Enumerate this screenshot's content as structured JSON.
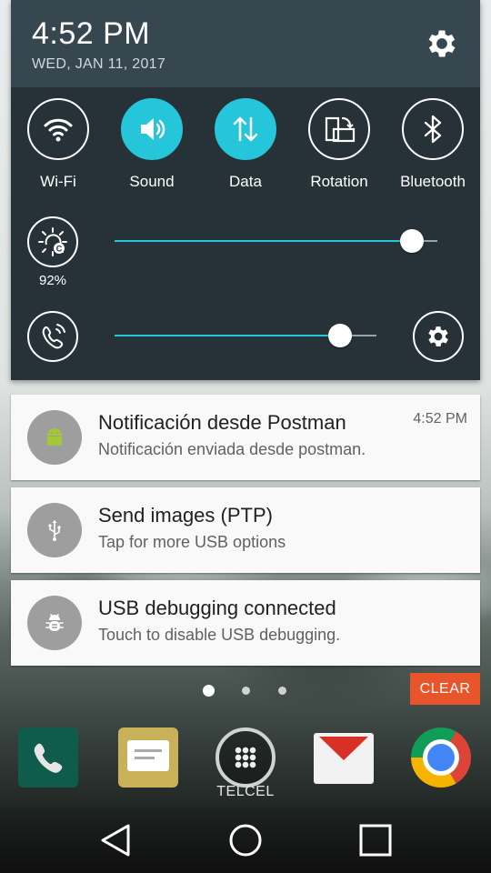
{
  "status": {
    "time": "4:52 PM",
    "date": "WED, JAN 11, 2017"
  },
  "quick_settings": {
    "toggles": [
      {
        "label": "Wi-Fi",
        "icon": "wifi-icon",
        "active": false
      },
      {
        "label": "Sound",
        "icon": "volume-icon",
        "active": true
      },
      {
        "label": "Data",
        "icon": "data-arrows-icon",
        "active": true
      },
      {
        "label": "Rotation",
        "icon": "rotation-icon",
        "active": false
      },
      {
        "label": "Bluetooth",
        "icon": "bluetooth-icon",
        "active": false
      }
    ],
    "brightness": {
      "percent_label": "92%",
      "level": 0.92
    },
    "volume": {
      "level": 0.86
    },
    "accent_color": "#26c6da"
  },
  "notifications": [
    {
      "title": "Notificación desde Postman",
      "text": "Notificación enviada desde postman.",
      "time": "4:52 PM",
      "icon": "android-icon"
    },
    {
      "title": "Send images (PTP)",
      "text": "Tap for more USB options",
      "time": "",
      "icon": "usb-icon"
    },
    {
      "title": "USB debugging connected",
      "text": "Touch to disable USB debugging.",
      "time": "",
      "icon": "bug-icon"
    }
  ],
  "clear_label": "CLEAR",
  "clear_color": "#e8552a",
  "dock": {
    "carrier_label": "TELCEL"
  }
}
